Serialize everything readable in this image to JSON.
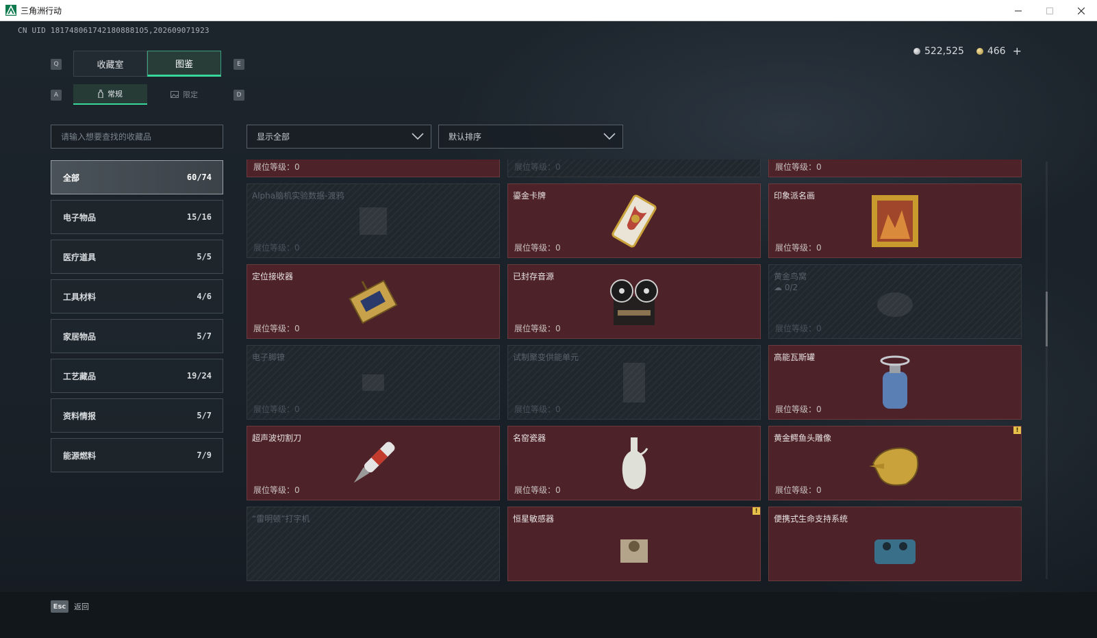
{
  "window": {
    "title": "三角洲行动"
  },
  "uid": "CN UID 1817480617421808881O5,202609071923",
  "currency": {
    "silver": "522,525",
    "gold": "466",
    "plus": "+"
  },
  "keys": {
    "main_prev": "Q",
    "main_next": "E",
    "sub_prev": "A",
    "sub_next": "D"
  },
  "main_tabs": [
    "收藏室",
    "图鉴"
  ],
  "sub_tabs": [
    "常规",
    "限定"
  ],
  "search": {
    "placeholder": "请输入想要查找的收藏品"
  },
  "filters": {
    "show": "显示全部",
    "sort": "默认排序"
  },
  "categories": [
    {
      "label": "全部",
      "count": "60/74"
    },
    {
      "label": "电子物品",
      "count": "15/16"
    },
    {
      "label": "医疗道具",
      "count": "5/5"
    },
    {
      "label": "工具材料",
      "count": "4/6"
    },
    {
      "label": "家居物品",
      "count": "5/7"
    },
    {
      "label": "工艺藏品",
      "count": "19/24"
    },
    {
      "label": "资料情报",
      "count": "5/7"
    },
    {
      "label": "能源燃料",
      "count": "7/9"
    }
  ],
  "level_label": "展位等级：",
  "items": [
    {
      "name": "",
      "level": "0",
      "icon": "caviar-tin-icon"
    },
    {
      "name": "",
      "level": "0",
      "icon": "locked-item-icon"
    },
    {
      "name": "",
      "level": "0",
      "icon": "blueprint-document-icon"
    },
    {
      "name": "Alpha脑机实验数据-渡鸦",
      "level": "0",
      "icon": "data-drive-icon"
    },
    {
      "name": "鎏金卡牌",
      "level": "0",
      "icon": "gilded-card-icon"
    },
    {
      "name": "印象派名画",
      "level": "0",
      "icon": "framed-painting-icon"
    },
    {
      "name": "定位接收器",
      "level": "0",
      "icon": "gps-receiver-icon"
    },
    {
      "name": "已封存音源",
      "level": "0",
      "icon": "reel-tape-recorder-icon"
    },
    {
      "name": "黄金鸟窝",
      "sub": "0/2",
      "level": "0",
      "icon": "golden-nest-icon"
    },
    {
      "name": "电子脚镣",
      "level": "0",
      "icon": "ankle-monitor-icon"
    },
    {
      "name": "试制聚变供能单元",
      "level": "0",
      "icon": "fusion-cell-icon"
    },
    {
      "name": "高能瓦斯罐",
      "level": "0",
      "icon": "gas-canister-icon"
    },
    {
      "name": "超声波切割刀",
      "level": "0",
      "icon": "ultrasonic-cutter-icon"
    },
    {
      "name": "名窑瓷器",
      "level": "0",
      "icon": "porcelain-vase-icon"
    },
    {
      "name": "黄金鳄鱼头雕像",
      "level": "0",
      "icon": "gold-crocodile-head-icon",
      "flag": "!"
    },
    {
      "name": "“雷明顿”打字机",
      "level": "",
      "icon": "typewriter-icon"
    },
    {
      "name": "恒星敏感器",
      "level": "",
      "icon": "star-sensor-icon",
      "flag": "!"
    },
    {
      "name": "便携式生命支持系统",
      "level": "",
      "icon": "life-support-icon"
    }
  ],
  "footer": {
    "esc": "Esc",
    "back": "返回"
  }
}
